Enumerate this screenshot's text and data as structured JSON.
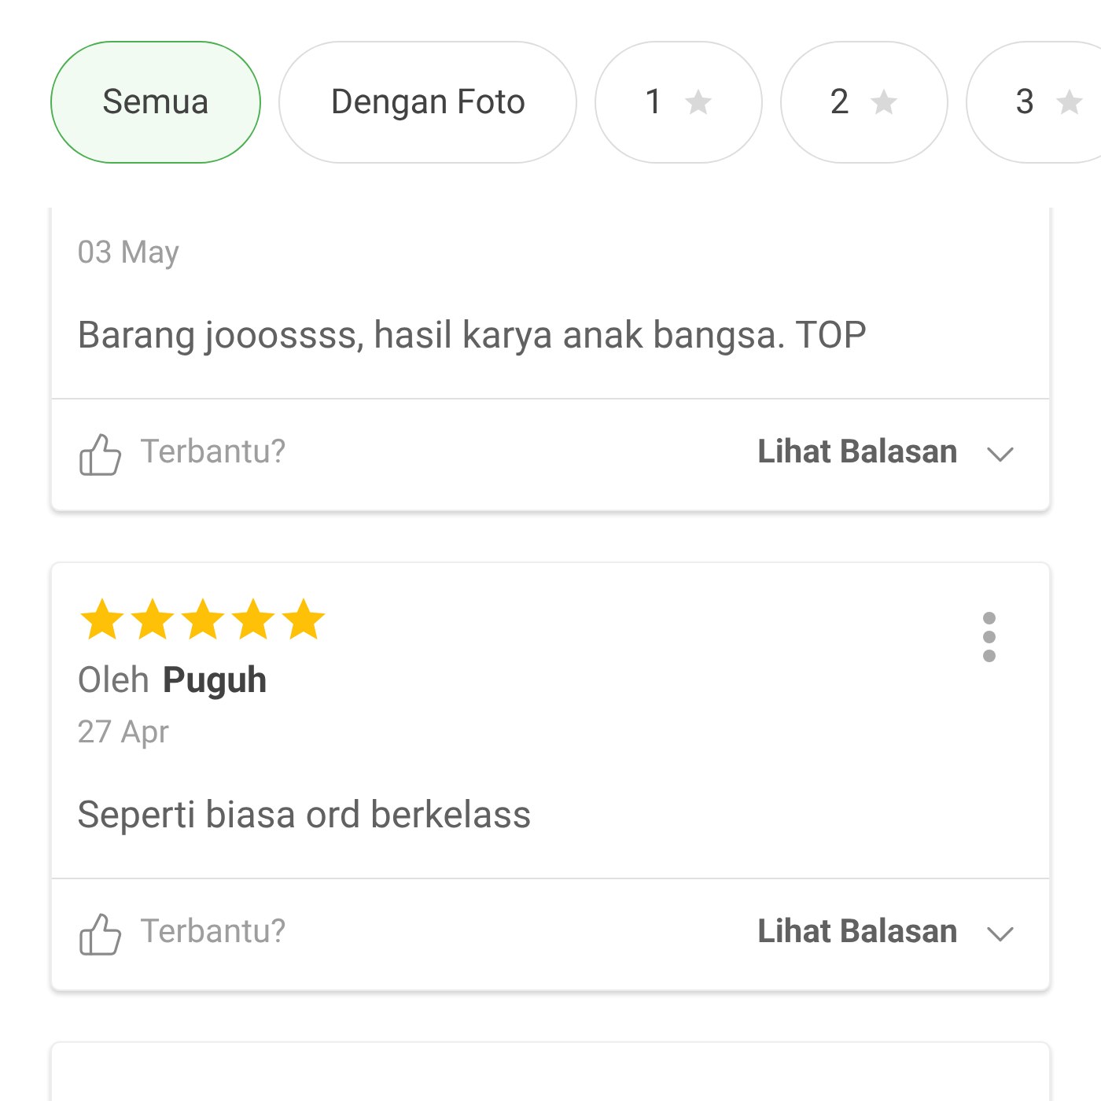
{
  "filters": [
    {
      "kind": "text",
      "label": "Semua",
      "selected": true
    },
    {
      "kind": "text",
      "label": "Dengan Foto",
      "selected": false
    },
    {
      "kind": "rating",
      "label": "1",
      "selected": false
    },
    {
      "kind": "rating",
      "label": "2",
      "selected": false
    },
    {
      "kind": "rating",
      "label": "3",
      "selected": false
    }
  ],
  "reviews": [
    {
      "date": "03 May",
      "text": "Barang jooossss, hasil karya anak bangsa. TOP",
      "helpful": "Terbantu?",
      "replies": "Lihat Balasan"
    },
    {
      "stars": 5,
      "by": "Oleh",
      "author": "Puguh",
      "date": "27 Apr",
      "text": "Seperti biasa ord berkelass",
      "helpful": "Terbantu?",
      "replies": "Lihat Balasan"
    }
  ]
}
